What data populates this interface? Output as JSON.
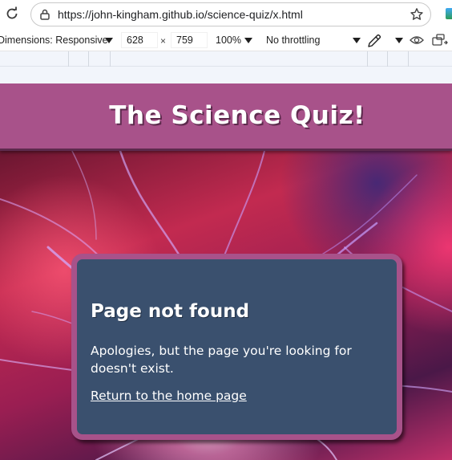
{
  "browser": {
    "url": "https://john-kingham.github.io/science-quiz/x.html",
    "icons": [
      "reload-icon",
      "lock-icon",
      "star-icon"
    ]
  },
  "devtools": {
    "dimensions_label": "Dimensions: Responsive",
    "width_value": "628",
    "separator": "×",
    "height_value": "759",
    "zoom_label": "100%",
    "throttling_label": "No throttling",
    "icons": [
      "eyedropper-icon",
      "eye-icon",
      "device-rotate-icon"
    ]
  },
  "site": {
    "title": "The Science Quiz!",
    "colors": {
      "header": "#a8528a",
      "card": "#3a506e"
    }
  },
  "error_card": {
    "heading": "Page not found",
    "message": "Apologies, but the page you're looking for doesn't exist.",
    "link_text": "Return to the home page"
  }
}
